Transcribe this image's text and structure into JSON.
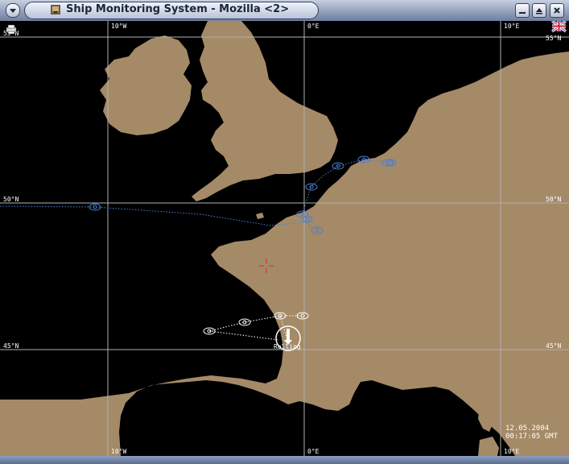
{
  "window": {
    "title": "Ship Monitoring System - Mozilla <2>",
    "menu_icon": "chevron-down-icon",
    "app_icon": "ship-app-icon",
    "buttons": [
      "minimize-icon",
      "maximize-icon",
      "close-icon"
    ]
  },
  "map": {
    "land_color": "#a58a67",
    "sea_color": "#000000",
    "grid_color": "#b0b0b0",
    "lon_labels_top": [
      "10°W",
      "0°E",
      "10°E"
    ],
    "lon_labels_bottom": [
      "10°W",
      "0°E",
      "10°E"
    ],
    "lat_labels_left": [
      "55°N",
      "50°N",
      "45°N"
    ],
    "lat_labels_right": [
      "55°N",
      "50°N",
      "45°N"
    ],
    "flag_icon": "uk-flag-icon",
    "printer_icon": "printer-icon",
    "crosshair_icon": "crosshair-icon",
    "selected_vessel_label": "Rolling",
    "timestamp": {
      "date": "12.05.2004",
      "time": "00:17:05 GMT"
    },
    "track_colors": {
      "blue": "#4a7fd6",
      "white": "#ffffff",
      "crosshair": "#e02020"
    }
  }
}
